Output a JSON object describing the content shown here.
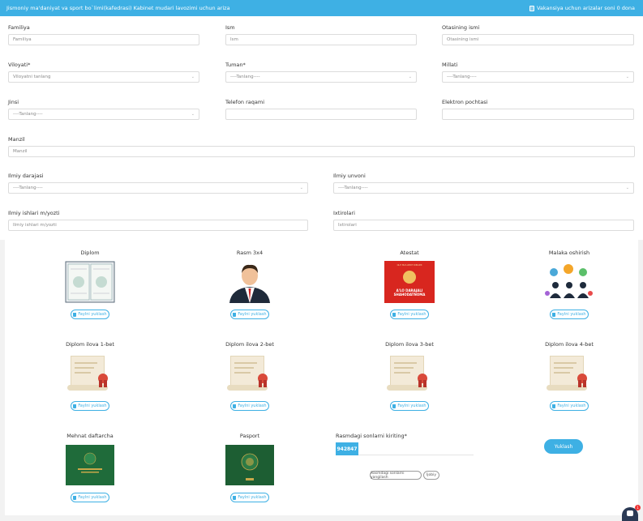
{
  "header": {
    "title": "Jismoniy ma'daniyat va sport bo`limi(kafedrasi) Kabinet mudari lavozimi uchun ariza",
    "right_text": "Vakansiya uchun arizalar soni 0 dona"
  },
  "form": {
    "familiya": {
      "label": "Familiya",
      "placeholder": "Familiya"
    },
    "ism": {
      "label": "Ism",
      "placeholder": "Ism"
    },
    "otasi": {
      "label": "Otasining ismi",
      "placeholder": "Otasining ismi"
    },
    "viloyat": {
      "label": "Viloyati*",
      "value": "Viloyatni tanlang"
    },
    "tuman": {
      "label": "Tuman*",
      "value": "----Tanlang----"
    },
    "millati": {
      "label": "Millati",
      "value": "----Tanlang----"
    },
    "jinsi": {
      "label": "Jinsi",
      "value": "----Tanlang----"
    },
    "telefon": {
      "label": "Telefon raqami",
      "value": ""
    },
    "email": {
      "label": "Elektron pochtasi",
      "value": ""
    },
    "manzil": {
      "label": "Manzil",
      "placeholder": "Manzil"
    },
    "ilmiy_daraja": {
      "label": "Ilmiy darajasi",
      "value": "----Tanlang----"
    },
    "ilmiy_unvon": {
      "label": "Ilmiy unvoni",
      "value": "----Tanlang----"
    },
    "ilmiy_ishlar": {
      "label": "Ilmiy ishlari m/yozti",
      "placeholder": "Ilmiy ishlari m/yozti"
    },
    "ixtirolari": {
      "label": "Ixtirolari",
      "placeholder": "Ixtirolari"
    }
  },
  "uploads": {
    "button_label": "Faylni yuklash",
    "items": [
      {
        "title": "Diplom",
        "icon": "diploma-certificate-icon"
      },
      {
        "title": "Rasm 3x4",
        "icon": "person-avatar-icon"
      },
      {
        "title": "Atestat",
        "icon": "red-certificate-icon"
      },
      {
        "title": "Malaka oshirish",
        "icon": "training-people-icon"
      },
      {
        "title": "Diplom ilova 1-bet",
        "icon": "scroll-document-icon"
      },
      {
        "title": "Diplom ilova 2-bet",
        "icon": "scroll-document-icon"
      },
      {
        "title": "Diplom ilova 3-bet",
        "icon": "scroll-document-icon"
      },
      {
        "title": "Diplom ilova 4-bet",
        "icon": "scroll-document-icon"
      },
      {
        "title": "Mehnat daftarcha",
        "icon": "green-booklet-icon"
      },
      {
        "title": "Pasport",
        "icon": "passport-icon"
      }
    ],
    "red_cert_text": "OLIY MA'LUMOT DIPLOMI",
    "red_cert_big": "A'LO DARAJALI SHAHODATNOMA"
  },
  "captcha": {
    "label": "Rasmdagi sonlarni kiriting*",
    "code": "942847",
    "refresh_label": "Rasmdagi sonlarni yangilash",
    "ok_label": "Ijobiy"
  },
  "submit_label": "Yuklash",
  "chat_badge": "1",
  "colors": {
    "accent": "#3eb0e4"
  }
}
